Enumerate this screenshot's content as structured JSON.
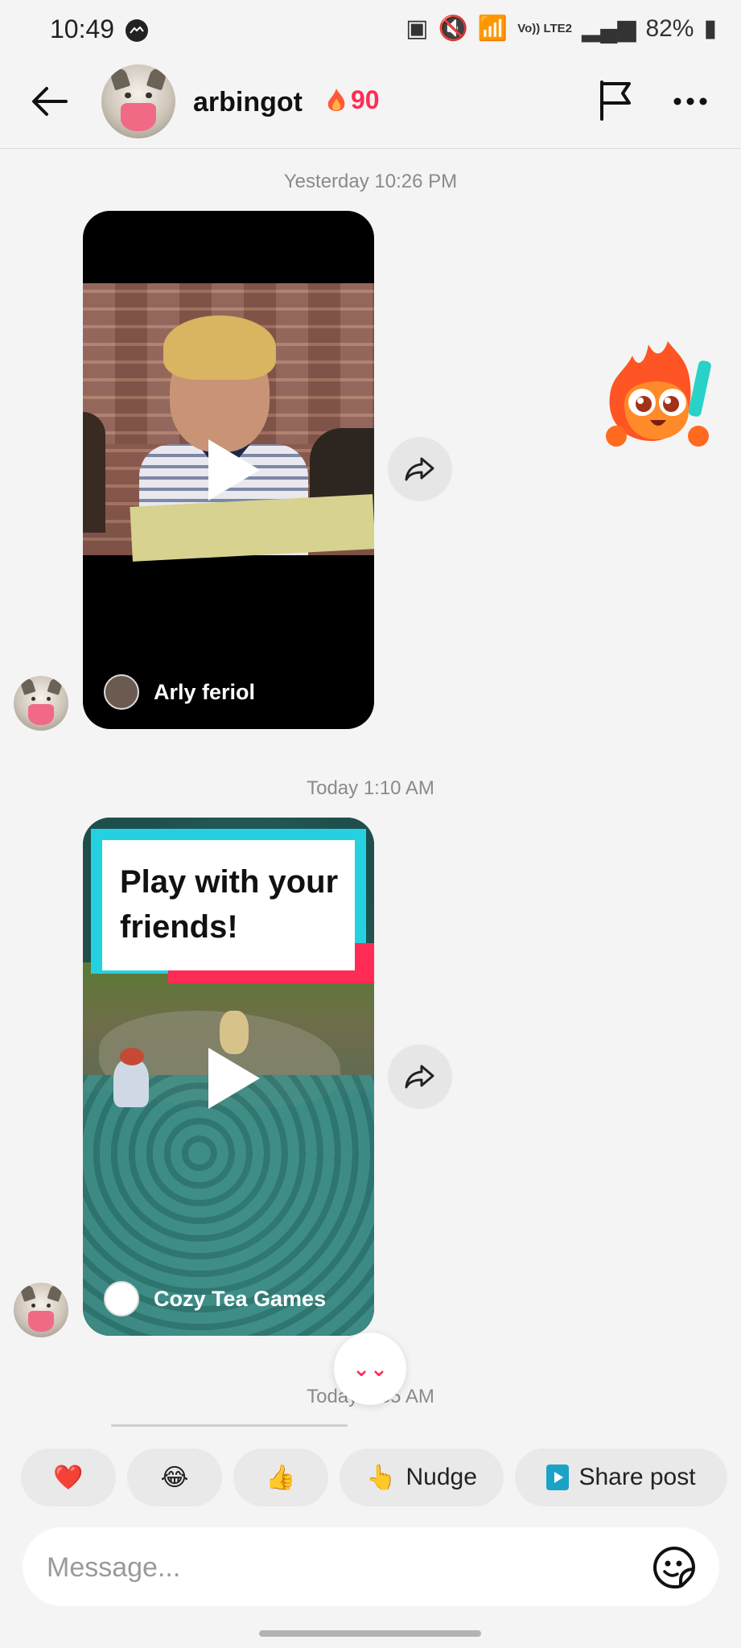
{
  "status_bar": {
    "time": "10:49",
    "signal_label": "Vo)) LTE2",
    "battery": "82%"
  },
  "header": {
    "username": "arbingot",
    "streak_count": "90",
    "icons": [
      "back-arrow-icon",
      "flag-icon",
      "more-icon"
    ]
  },
  "messages": [
    {
      "timestamp": "Yesterday 10:26 PM",
      "type": "video",
      "author": "Arly feriol"
    },
    {
      "timestamp": "Today 1:10 AM",
      "type": "video",
      "banner_text": "Play with your friends!",
      "author": "Cozy Tea Games"
    },
    {
      "timestamp": "Today 1:35 AM"
    }
  ],
  "quick_replies": [
    {
      "emoji": "❤️"
    },
    {
      "emoji": "😂"
    },
    {
      "emoji": "👍"
    },
    {
      "emoji": "👆",
      "label": "Nudge"
    },
    {
      "label": "Share post"
    }
  ],
  "composer": {
    "placeholder": "Message..."
  },
  "colors": {
    "accent": "#fe2c55",
    "banner_cyan": "#25d1e0",
    "background": "#f4f4f4"
  }
}
